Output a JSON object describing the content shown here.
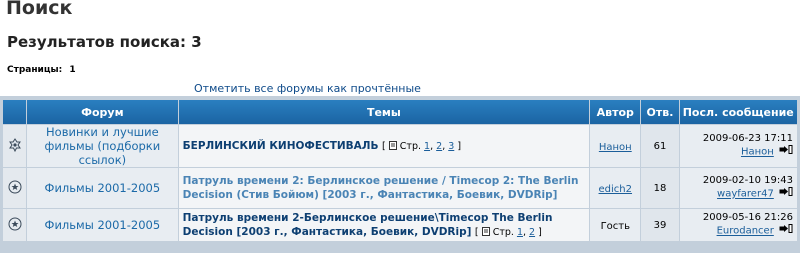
{
  "page": {
    "title": "Поиск",
    "results_title": "Результатов поиска: 3",
    "pages_label": "Страницы:",
    "pages_value": "1",
    "mark_all_read": "Отметить все форумы как прочтённые"
  },
  "table": {
    "headers": {
      "forum": "Форум",
      "topics": "Темы",
      "author": "Автор",
      "replies": "Отв.",
      "last_post": "Посл. сообщение"
    },
    "rows": [
      {
        "icon": "sticky-topic-icon",
        "forum": "Новинки и лучшие фильмы (подборки ссылок)",
        "topic": "БЕРЛИНСКИЙ КИНОФЕСТИВАЛЬ",
        "pages_prefix": "[",
        "pages_label": "Стр.",
        "pages": [
          "1",
          "2",
          "3"
        ],
        "pages_suffix": "]",
        "author": "Нанон",
        "replies": "61",
        "last_date": "2009-06-23 17:11",
        "last_user": "Нанон"
      },
      {
        "icon": "topic-icon",
        "forum": "Фильмы 2001-2005",
        "topic": "Патруль времени 2: Берлинское решение / Timecop 2: The Berlin Decision (Стив Бойюм) [2003 г., Фантастика, Боевик, DVDRip]",
        "author": "edich2",
        "replies": "18",
        "last_date": "2009-02-10 19:43",
        "last_user": "wayfarer47"
      },
      {
        "icon": "topic-icon",
        "forum": "Фильмы 2001-2005",
        "topic": "Патруль времени 2-Берлинское решение\\Timecop The Berlin Decision [2003 г., Фантастика, Боевик, DVDRip]",
        "pages_prefix": "[",
        "pages_label": "Стр.",
        "pages": [
          "1",
          "2"
        ],
        "pages_suffix": "]",
        "author": "Гость",
        "replies": "39",
        "last_date": "2009-05-16 21:26",
        "last_user": "Eurodancer"
      }
    ]
  }
}
